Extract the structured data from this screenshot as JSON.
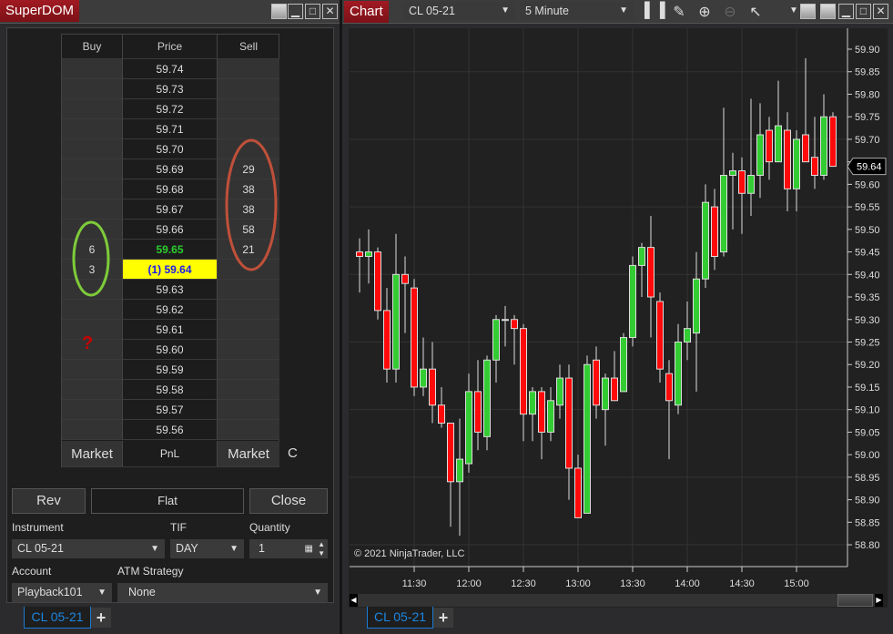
{
  "superdom": {
    "title": "SuperDOM",
    "headers": {
      "buy": "Buy",
      "price": "Price",
      "sell": "Sell"
    },
    "rows": [
      {
        "price": "59.74",
        "buy": "",
        "sell": ""
      },
      {
        "price": "59.73",
        "buy": "",
        "sell": ""
      },
      {
        "price": "59.72",
        "buy": "",
        "sell": ""
      },
      {
        "price": "59.71",
        "buy": "",
        "sell": ""
      },
      {
        "price": "59.70",
        "buy": "",
        "sell": ""
      },
      {
        "price": "59.69",
        "buy": "",
        "sell": "29"
      },
      {
        "price": "59.68",
        "buy": "",
        "sell": "38"
      },
      {
        "price": "59.67",
        "buy": "",
        "sell": "38"
      },
      {
        "price": "59.66",
        "buy": "",
        "sell": "58"
      },
      {
        "price": "59.65",
        "buy": "6",
        "sell": "21"
      },
      {
        "price": "(1) 59.64",
        "buy": "3",
        "sell": ""
      },
      {
        "price": "59.63",
        "buy": "",
        "sell": ""
      },
      {
        "price": "59.62",
        "buy": "",
        "sell": ""
      },
      {
        "price": "59.61",
        "buy": "",
        "sell": ""
      },
      {
        "price": "59.60",
        "buy": "",
        "sell": ""
      },
      {
        "price": "59.59",
        "buy": "",
        "sell": ""
      },
      {
        "price": "59.58",
        "buy": "",
        "sell": ""
      },
      {
        "price": "59.57",
        "buy": "",
        "sell": ""
      },
      {
        "price": "59.56",
        "buy": "",
        "sell": ""
      }
    ],
    "last_trade_row": 9,
    "position_row": 10,
    "footer": {
      "buy_market": "Market",
      "pnl": "PnL",
      "sell_market": "Market",
      "c": "C"
    },
    "annotation_question": "?",
    "buttons": {
      "rev": "Rev",
      "flat": "Flat",
      "close": "Close"
    },
    "instrument_label": "Instrument",
    "instrument_value": "CL 05-21",
    "tif_label": "TIF",
    "tif_value": "DAY",
    "quantity_label": "Quantity",
    "quantity_value": "1",
    "account_label": "Account",
    "account_value": "Playback101",
    "atm_label": "ATM Strategy",
    "atm_value": "None",
    "tab": "CL 05-21",
    "add_tab": "+"
  },
  "chart": {
    "title": "Chart",
    "instrument": "CL 05-21",
    "interval": "5 Minute",
    "copyright": "© 2021 NinjaTrader, LLC",
    "last_price": "59.64",
    "tab": "CL 05-21",
    "add_tab": "+",
    "colors": {
      "up": "#33cc33",
      "down": "#ff0a0a",
      "bg": "#212121"
    }
  },
  "chart_data": {
    "type": "candlestick",
    "interval_minutes": 5,
    "ylim": [
      58.76,
      59.94
    ],
    "yticks": [
      "59.90",
      "59.85",
      "59.80",
      "59.75",
      "59.70",
      "59.65",
      "59.60",
      "59.55",
      "59.50",
      "59.45",
      "59.40",
      "59.35",
      "59.30",
      "59.25",
      "59.20",
      "59.15",
      "59.10",
      "59.05",
      "59.00",
      "58.95",
      "58.90",
      "58.85",
      "58.80"
    ],
    "xticks": [
      "11:30",
      "12:00",
      "12:30",
      "13:00",
      "13:30",
      "14:00",
      "14:30",
      "15:00"
    ],
    "first_bar_time": "11:00",
    "ohlc": [
      [
        59.45,
        59.48,
        59.36,
        59.44
      ],
      [
        59.44,
        59.5,
        59.38,
        59.45
      ],
      [
        59.45,
        59.46,
        59.3,
        59.32
      ],
      [
        59.32,
        59.37,
        59.16,
        59.19
      ],
      [
        59.19,
        59.49,
        59.16,
        59.4
      ],
      [
        59.4,
        59.44,
        59.27,
        59.38
      ],
      [
        59.37,
        59.39,
        59.13,
        59.15
      ],
      [
        59.15,
        59.26,
        59.13,
        59.19
      ],
      [
        59.19,
        59.25,
        59.07,
        59.11
      ],
      [
        59.11,
        59.15,
        59.06,
        59.07
      ],
      [
        59.07,
        59.07,
        58.84,
        58.94
      ],
      [
        58.94,
        59.08,
        58.82,
        58.99
      ],
      [
        58.98,
        59.18,
        58.96,
        59.14
      ],
      [
        59.14,
        59.21,
        59.01,
        59.05
      ],
      [
        59.04,
        59.22,
        59.01,
        59.21
      ],
      [
        59.21,
        59.31,
        59.16,
        59.3
      ],
      [
        59.3,
        59.33,
        59.24,
        59.3
      ],
      [
        59.3,
        59.31,
        59.2,
        59.28
      ],
      [
        59.28,
        59.29,
        59.03,
        59.09
      ],
      [
        59.09,
        59.15,
        59.03,
        59.14
      ],
      [
        59.14,
        59.15,
        58.99,
        59.05
      ],
      [
        59.05,
        59.15,
        59.03,
        59.12
      ],
      [
        59.11,
        59.2,
        59.08,
        59.17
      ],
      [
        59.17,
        59.2,
        58.9,
        58.97
      ],
      [
        58.97,
        59.0,
        58.86,
        58.86
      ],
      [
        58.87,
        59.22,
        58.87,
        59.2
      ],
      [
        59.21,
        59.24,
        59.08,
        59.11
      ],
      [
        59.1,
        59.18,
        59.02,
        59.17
      ],
      [
        59.17,
        59.23,
        59.12,
        59.12
      ],
      [
        59.14,
        59.27,
        59.14,
        59.26
      ],
      [
        59.26,
        59.44,
        59.24,
        59.42
      ],
      [
        59.42,
        59.47,
        59.35,
        59.46
      ],
      [
        59.46,
        59.53,
        59.26,
        59.35
      ],
      [
        59.34,
        59.36,
        59.16,
        59.19
      ],
      [
        59.18,
        59.21,
        58.99,
        59.12
      ],
      [
        59.11,
        59.29,
        59.09,
        59.25
      ],
      [
        59.25,
        59.34,
        59.21,
        59.28
      ],
      [
        59.27,
        59.45,
        59.14,
        59.39
      ],
      [
        59.39,
        59.6,
        59.37,
        59.56
      ],
      [
        59.55,
        59.59,
        59.41,
        59.44
      ],
      [
        59.45,
        59.77,
        59.44,
        59.62
      ],
      [
        59.62,
        59.67,
        59.5,
        59.63
      ],
      [
        59.63,
        59.66,
        59.49,
        59.58
      ],
      [
        59.58,
        59.79,
        59.53,
        59.62
      ],
      [
        59.62,
        59.78,
        59.57,
        59.71
      ],
      [
        59.72,
        59.75,
        59.61,
        59.65
      ],
      [
        59.65,
        59.83,
        59.65,
        59.73
      ],
      [
        59.72,
        59.76,
        59.54,
        59.59
      ],
      [
        59.59,
        59.72,
        59.54,
        59.7
      ],
      [
        59.71,
        59.88,
        59.65,
        59.65
      ],
      [
        59.66,
        59.75,
        59.59,
        59.62
      ],
      [
        59.62,
        59.8,
        59.61,
        59.75
      ],
      [
        59.75,
        59.76,
        59.64,
        59.64
      ]
    ]
  }
}
